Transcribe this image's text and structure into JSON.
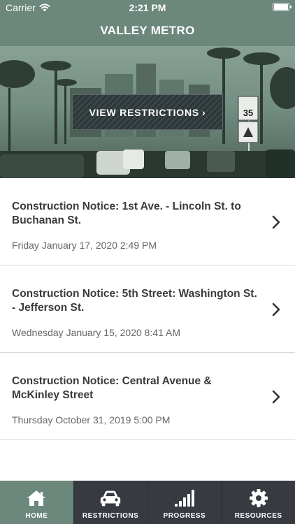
{
  "status_bar": {
    "carrier": "Carrier",
    "time": "2:21 PM"
  },
  "header": {
    "title": "VALLEY METRO"
  },
  "hero": {
    "button_label": "VIEW RESTRICTIONS",
    "button_chevron": "›",
    "sign_speed": "35"
  },
  "notices": [
    {
      "title": "Construction Notice: 1st Ave. - Lincoln St. to Buchanan St.",
      "date": "Friday January 17, 2020 2:49 PM"
    },
    {
      "title": "Construction Notice: 5th Street: Washington St. - Jefferson St.",
      "date": "Wednesday January 15, 2020 8:41 AM"
    },
    {
      "title": "Construction Notice: Central Avenue & McKinley Street",
      "date": "Thursday October 31, 2019 5:00 PM"
    }
  ],
  "tabs": [
    {
      "label": "HOME",
      "icon": "home-icon",
      "active": true
    },
    {
      "label": "RESTRICTIONS",
      "icon": "car-icon",
      "active": false
    },
    {
      "label": "PROGRESS",
      "icon": "signal-bars-icon",
      "active": false
    },
    {
      "label": "RESOURCES",
      "icon": "gear-icon",
      "active": false
    }
  ],
  "colors": {
    "brand_green": "#6c877b",
    "tab_dark": "#373a41",
    "text_dark": "#3a3a3a",
    "text_muted": "#666666"
  }
}
